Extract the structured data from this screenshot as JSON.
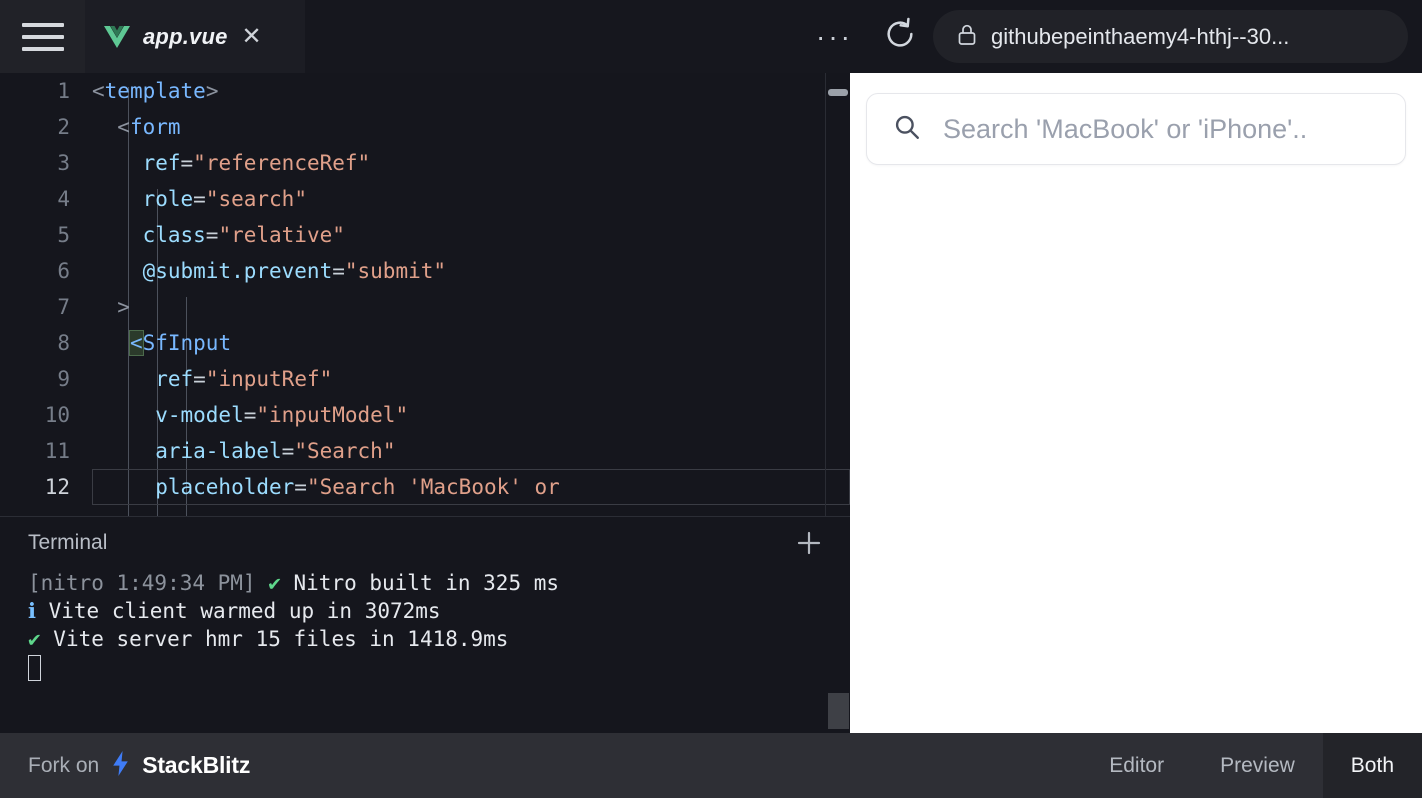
{
  "topbar": {
    "menu_icon": "hamburger-icon",
    "tab": {
      "label": "app.vue",
      "file_icon": "vue-logo-icon",
      "close_icon": "close-icon"
    },
    "more_icon": "ellipsis-icon",
    "more_label": "···",
    "reload_icon": "reload-icon",
    "url": {
      "lock_icon": "lock-icon",
      "text": "githubepeinthaemy4-hthj--30..."
    }
  },
  "editor": {
    "lines": [
      {
        "n": "1",
        "segments": [
          {
            "t": "<",
            "c": "punc"
          },
          {
            "t": "template",
            "c": "tag"
          },
          {
            "t": ">",
            "c": "punc"
          }
        ],
        "indent": 0
      },
      {
        "n": "2",
        "segments": [
          {
            "t": "  <",
            "c": "punc"
          },
          {
            "t": "form",
            "c": "tag"
          }
        ],
        "indent": 1
      },
      {
        "n": "3",
        "segments": [
          {
            "t": "    ref",
            "c": "attr"
          },
          {
            "t": "=",
            "c": "eq"
          },
          {
            "t": "\"referenceRef\"",
            "c": "str"
          }
        ],
        "indent": 2
      },
      {
        "n": "4",
        "segments": [
          {
            "t": "    role",
            "c": "attr"
          },
          {
            "t": "=",
            "c": "eq"
          },
          {
            "t": "\"search\"",
            "c": "str"
          }
        ],
        "indent": 2
      },
      {
        "n": "5",
        "segments": [
          {
            "t": "    class",
            "c": "attr"
          },
          {
            "t": "=",
            "c": "eq"
          },
          {
            "t": "\"relative\"",
            "c": "str"
          }
        ],
        "indent": 2
      },
      {
        "n": "6",
        "segments": [
          {
            "t": "    @submit.prevent",
            "c": "attr"
          },
          {
            "t": "=",
            "c": "eq"
          },
          {
            "t": "\"submit\"",
            "c": "str"
          }
        ],
        "indent": 2
      },
      {
        "n": "7",
        "segments": [
          {
            "t": "  >",
            "c": "punc"
          }
        ],
        "indent": 1
      },
      {
        "n": "8",
        "segments": [
          {
            "t": "   ",
            "c": "punc"
          },
          {
            "t": "<",
            "c": "bracket"
          },
          {
            "t": "SfInput",
            "c": "tag"
          }
        ],
        "indent": 2
      },
      {
        "n": "9",
        "segments": [
          {
            "t": "     ref",
            "c": "attr"
          },
          {
            "t": "=",
            "c": "eq"
          },
          {
            "t": "\"inputRef\"",
            "c": "str"
          }
        ],
        "indent": 3
      },
      {
        "n": "10",
        "segments": [
          {
            "t": "     v-model",
            "c": "attr"
          },
          {
            "t": "=",
            "c": "eq"
          },
          {
            "t": "\"inputModel\"",
            "c": "str"
          }
        ],
        "indent": 3
      },
      {
        "n": "11",
        "segments": [
          {
            "t": "     aria-label",
            "c": "attr"
          },
          {
            "t": "=",
            "c": "eq"
          },
          {
            "t": "\"Search\"",
            "c": "str"
          }
        ],
        "indent": 3
      },
      {
        "n": "12",
        "segments": [
          {
            "t": "     placeholder",
            "c": "attr"
          },
          {
            "t": "=",
            "c": "eq"
          },
          {
            "t": "\"Search 'MacBook' or",
            "c": "str"
          }
        ],
        "indent": 3,
        "active": true
      }
    ]
  },
  "terminal": {
    "title": "Terminal",
    "add_icon": "plus-icon",
    "lines": [
      {
        "parts": [
          {
            "t": "[nitro 1:49:34 PM] ",
            "c": "dim"
          },
          {
            "t": "✔",
            "c": "ok"
          },
          {
            "t": " Nitro built in 325 ms",
            "c": "txt"
          }
        ]
      },
      {
        "parts": [
          {
            "t": "ℹ",
            "c": "info"
          },
          {
            "t": " Vite client warmed up in 3072ms",
            "c": "txt"
          }
        ]
      },
      {
        "parts": [
          {
            "t": "✔",
            "c": "ok"
          },
          {
            "t": " Vite server hmr 15 files in 1418.9ms",
            "c": "txt"
          }
        ]
      }
    ]
  },
  "preview": {
    "search": {
      "icon": "search-icon",
      "placeholder": "Search 'MacBook' or 'iPhone'.."
    }
  },
  "statusbar": {
    "fork_prefix": "Fork on",
    "fork_icon": "lightning-bolt-icon",
    "fork_brand": "StackBlitz",
    "view_tabs": [
      {
        "label": "Editor",
        "active": false
      },
      {
        "label": "Preview",
        "active": false
      },
      {
        "label": "Both",
        "active": true
      }
    ]
  },
  "colors": {
    "editor_bg": "#15161d",
    "topbar_bg": "#16171e",
    "tab_bg": "#1c1d24",
    "statusbar_bg": "#2e2f35",
    "vue_green": "#5ec894",
    "bolt_blue": "#3f7cf6",
    "string": "#e0a08a",
    "tag": "#79b8ff",
    "attr": "#9cdcfe",
    "success": "#5ed68b"
  }
}
